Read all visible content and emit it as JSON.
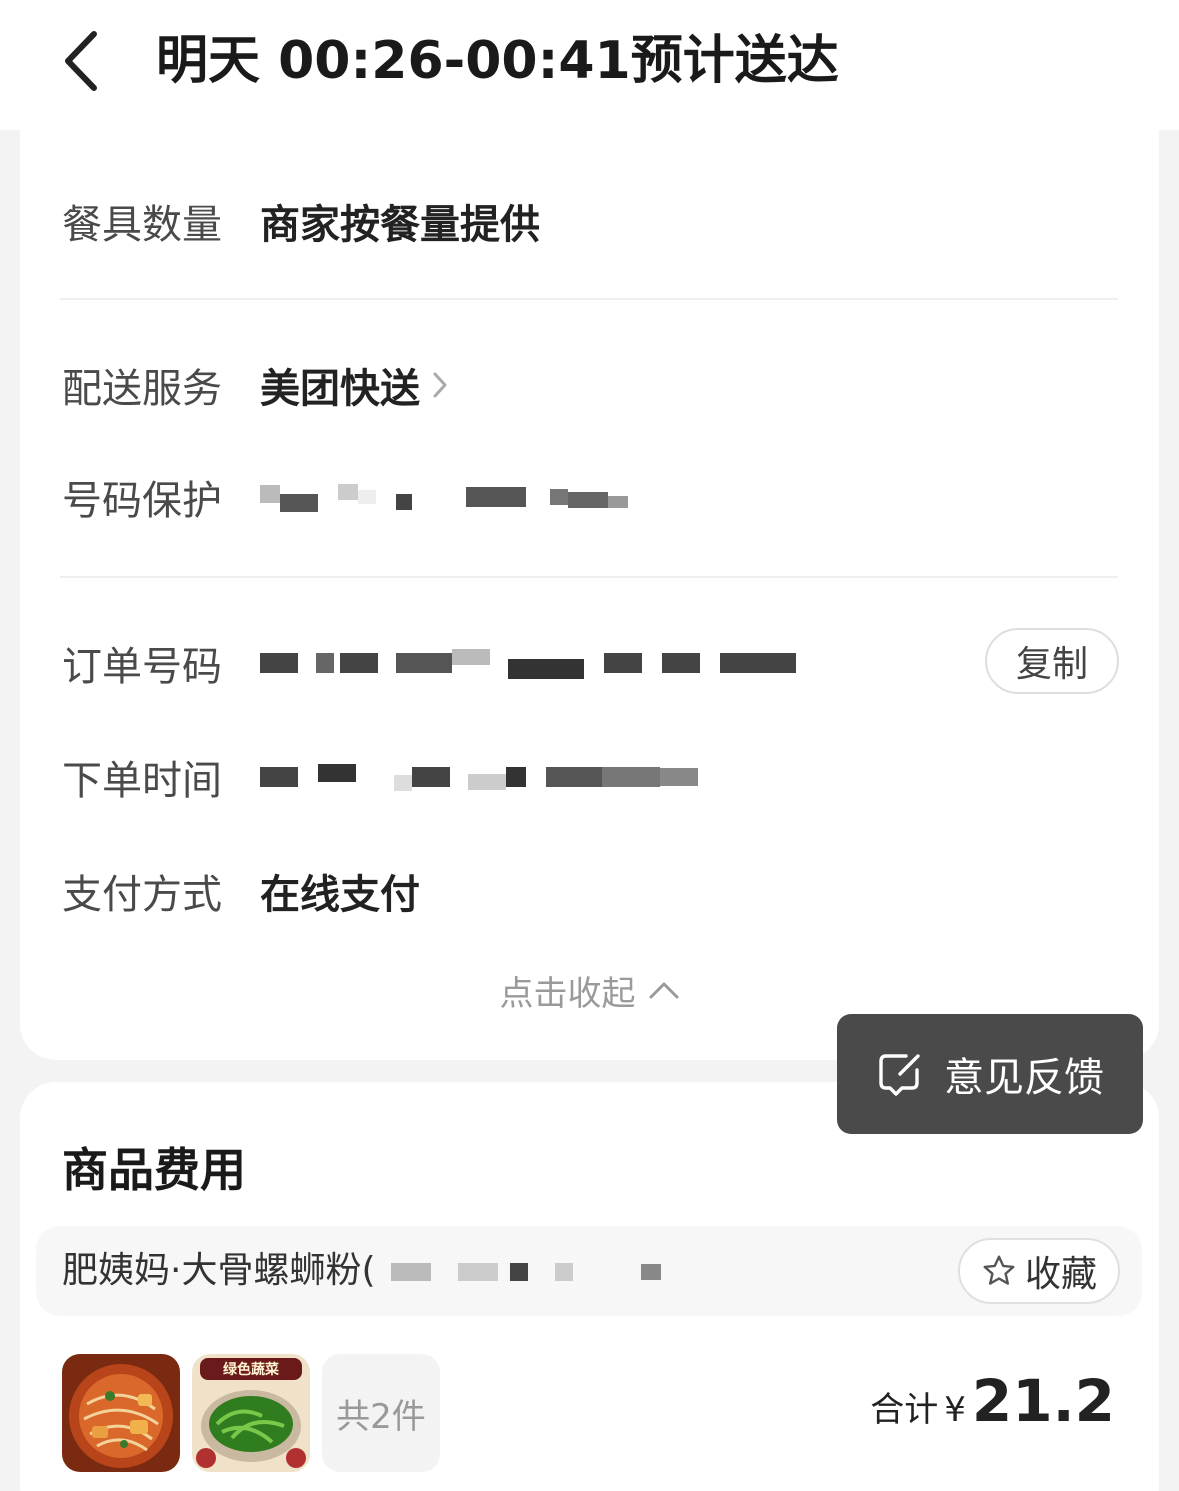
{
  "header": {
    "title": "明天 00:26-00:41预计送达",
    "back_icon": "back-chevron-icon"
  },
  "details": {
    "tableware": {
      "label": "餐具数量",
      "value": "商家按餐量提供"
    },
    "delivery": {
      "label": "配送服务",
      "value": "美团快送"
    },
    "number_protect": {
      "label": "号码保护"
    },
    "order_number": {
      "label": "订单号码",
      "copy_label": "复制"
    },
    "order_time": {
      "label": "下单时间"
    },
    "payment": {
      "label": "支付方式",
      "value": "在线支付"
    },
    "collapse_label": "点击收起"
  },
  "goods": {
    "title": "商品费用",
    "shop_name": "肥姨妈·大骨螺蛳粉(",
    "favorite_label": "收藏",
    "count_label": "共2件",
    "total_label": "合计",
    "currency": "¥",
    "total_amount": "21.2",
    "items": [
      {
        "name": "螺蛳粉",
        "icon": "food-noodle-image"
      },
      {
        "name": "绿色蔬菜",
        "icon": "food-vegetable-image"
      }
    ],
    "veg_caption": "绿色蔬菜"
  },
  "feedback": {
    "label": "意见反馈"
  }
}
